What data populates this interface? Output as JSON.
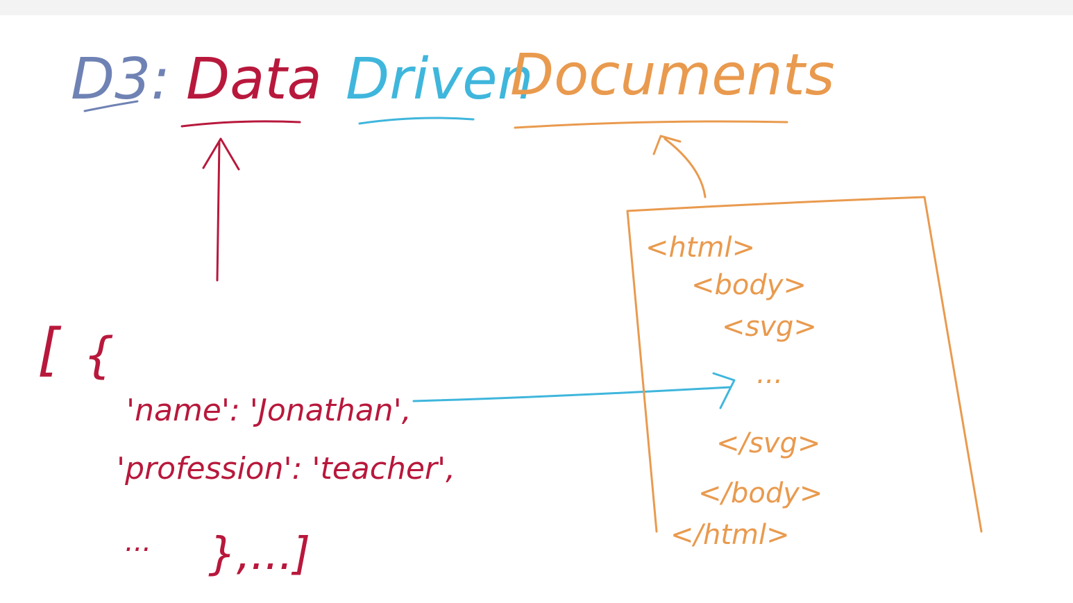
{
  "title": {
    "prefix": "D3:",
    "word_data": "Data",
    "word_driven": "Driven",
    "word_documents": "Documents"
  },
  "data_array": {
    "open_bracket": "[",
    "open_brace": "{",
    "line_name": "'name': 'Jonathan',",
    "line_profession": "'profession': 'teacher',",
    "ellipsis": "...",
    "close": "},...]"
  },
  "document": {
    "html_open": "<html>",
    "body_open": "<body>",
    "svg_open": "<svg>",
    "dots": "...",
    "svg_close": "</svg>",
    "body_close": "</body>",
    "html_close": "</html>"
  },
  "colors": {
    "blue_grey": "#6f82b4",
    "crimson": "#b8183c",
    "cyan": "#3fb6dc",
    "orange": "#e99a4e"
  }
}
